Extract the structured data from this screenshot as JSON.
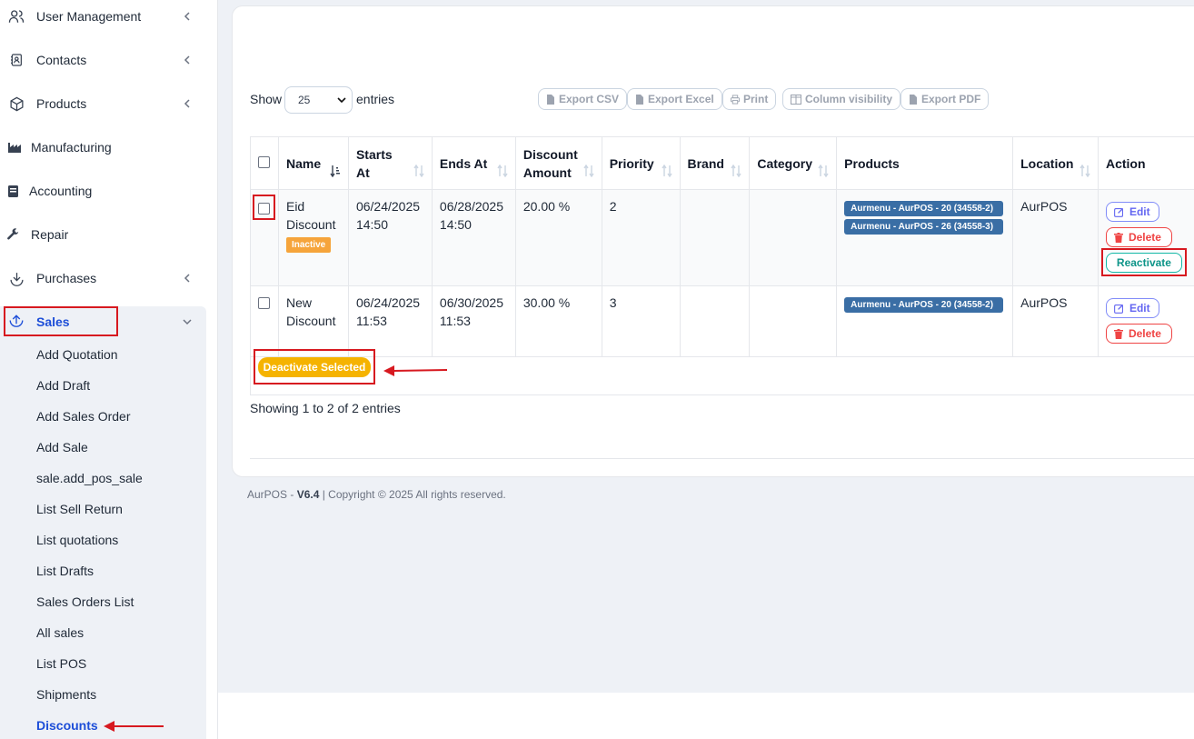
{
  "sidebar": {
    "items": [
      {
        "label": "User Management",
        "icon": "users-icon",
        "has_submenu": true
      },
      {
        "label": "Contacts",
        "icon": "address-book-icon",
        "has_submenu": true
      },
      {
        "label": "Products",
        "icon": "cube-icon",
        "has_submenu": true
      },
      {
        "label": "Manufacturing",
        "icon": "factory-icon",
        "has_submenu": false
      },
      {
        "label": "Accounting",
        "icon": "book-icon",
        "has_submenu": false
      },
      {
        "label": "Repair",
        "icon": "wrench-icon",
        "has_submenu": false
      },
      {
        "label": "Purchases",
        "icon": "download-icon",
        "has_submenu": true
      },
      {
        "label": "Sales",
        "icon": "upload-icon",
        "has_submenu": true,
        "expanded": true
      }
    ],
    "sales_submenu": [
      "Add Quotation",
      "Add Draft",
      "Add Sales Order",
      "Add Sale",
      "sale.add_pos_sale",
      "List Sell Return",
      "List quotations",
      "List Drafts",
      "Sales Orders List",
      "All sales",
      "List POS",
      "Shipments",
      "Discounts"
    ],
    "active_subitem": "Discounts"
  },
  "table_controls": {
    "show_label": "Show",
    "page_length": "25",
    "entries_label": "entries",
    "buttons": [
      "Export CSV",
      "Export Excel",
      "Print",
      "Column visibility",
      "Export PDF"
    ]
  },
  "table": {
    "columns": [
      "Name",
      "Starts At",
      "Ends At",
      "Discount Amount",
      "Priority",
      "Brand",
      "Category",
      "Products",
      "Location",
      "Action"
    ],
    "rows": [
      {
        "name": "Eid Discount",
        "status": "Inactive",
        "starts_at": "06/24/2025 14:50",
        "ends_at": "06/28/2025 14:50",
        "discount_amount": "20.00 %",
        "priority": "2",
        "brand": "",
        "category": "",
        "products": [
          "Aurmenu - AurPOS - 20 (34558-2)",
          "Aurmenu - AurPOS - 26 (34558-3)"
        ],
        "location": "AurPOS",
        "actions": [
          "Edit",
          "Delete",
          "Reactivate"
        ]
      },
      {
        "name": "New Discount",
        "status": "",
        "starts_at": "06/24/2025 11:53",
        "ends_at": "06/30/2025 11:53",
        "discount_amount": "30.00 %",
        "priority": "3",
        "brand": "",
        "category": "",
        "products": [
          "Aurmenu - AurPOS - 20 (34558-2)"
        ],
        "location": "AurPOS",
        "actions": [
          "Edit",
          "Delete"
        ]
      }
    ],
    "bulk_action": "Deactivate Selected",
    "info": "Showing 1 to 2 of 2 entries"
  },
  "footer": {
    "app": "AurPOS - ",
    "version": "V6.4",
    "copyright": " | Copyright © 2025 All rights reserved."
  },
  "colors": {
    "accent": "#1d4ed8",
    "annotation": "#d71920",
    "inactive_badge": "#f6a43b",
    "product_badge": "#3a6ea5",
    "deactivate_button": "#f5b301"
  }
}
